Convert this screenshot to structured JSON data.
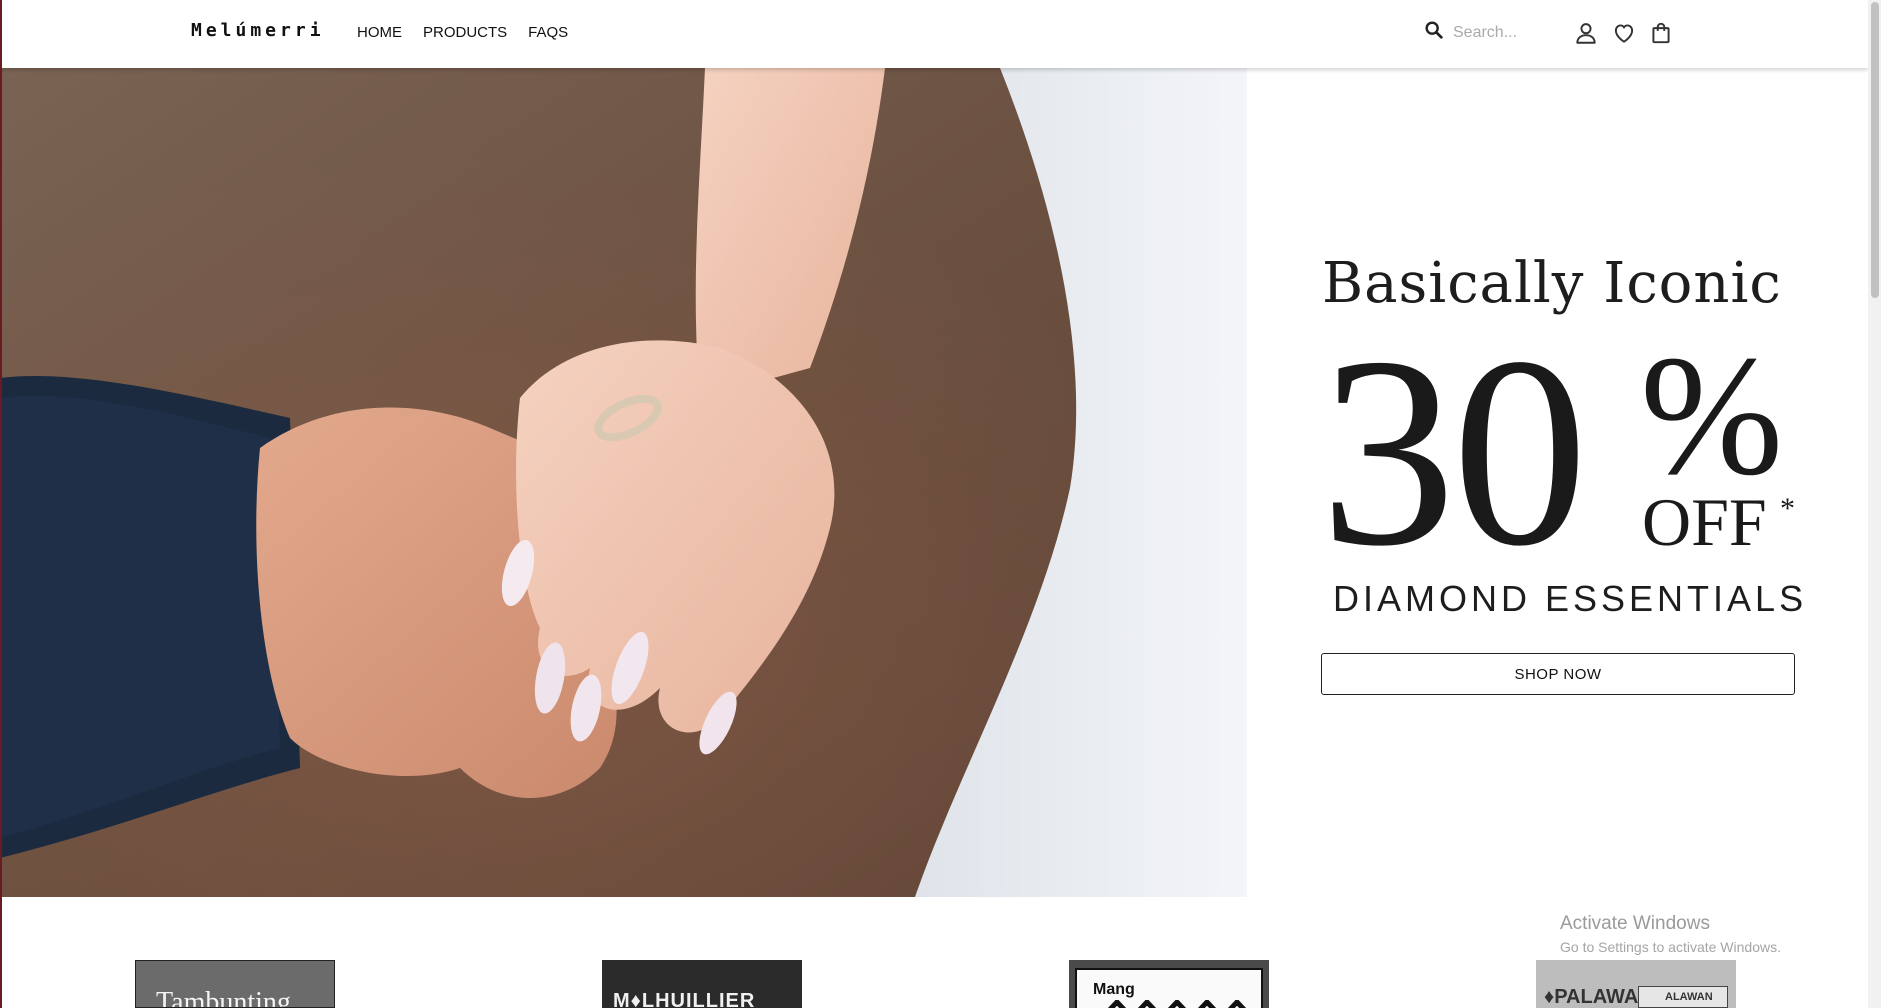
{
  "header": {
    "brand": "Melúmerri",
    "nav": [
      {
        "label": "HOME"
      },
      {
        "label": "PRODUCTS"
      },
      {
        "label": "FAQS"
      }
    ],
    "search": {
      "placeholder": "Search..."
    },
    "icons": [
      "search-icon",
      "user-icon",
      "heart-icon",
      "shopping-bag-icon"
    ]
  },
  "hero": {
    "image": "couple-holding-hands-ring-photo",
    "headline": "Basically Iconic",
    "discount_number": "30",
    "discount_percent": "%",
    "discount_off": "OFF",
    "discount_asterisk": "*",
    "subheadline": "DIAMOND ESSENTIALS",
    "cta_label": "SHOP NOW"
  },
  "partners": [
    {
      "text": "Tambunting"
    },
    {
      "text": "M♦LHUILLIER"
    },
    {
      "text": "Mang"
    },
    {
      "text": "♦PALAWAN",
      "badge": "ALAWAN"
    }
  ],
  "watermark": {
    "title": "Activate Windows",
    "subtitle": "Go to Settings to activate Windows."
  },
  "colors": {
    "text": "#111111",
    "left_edge": "#6a1a22",
    "scrollbar_thumb": "#c1c1c1"
  }
}
